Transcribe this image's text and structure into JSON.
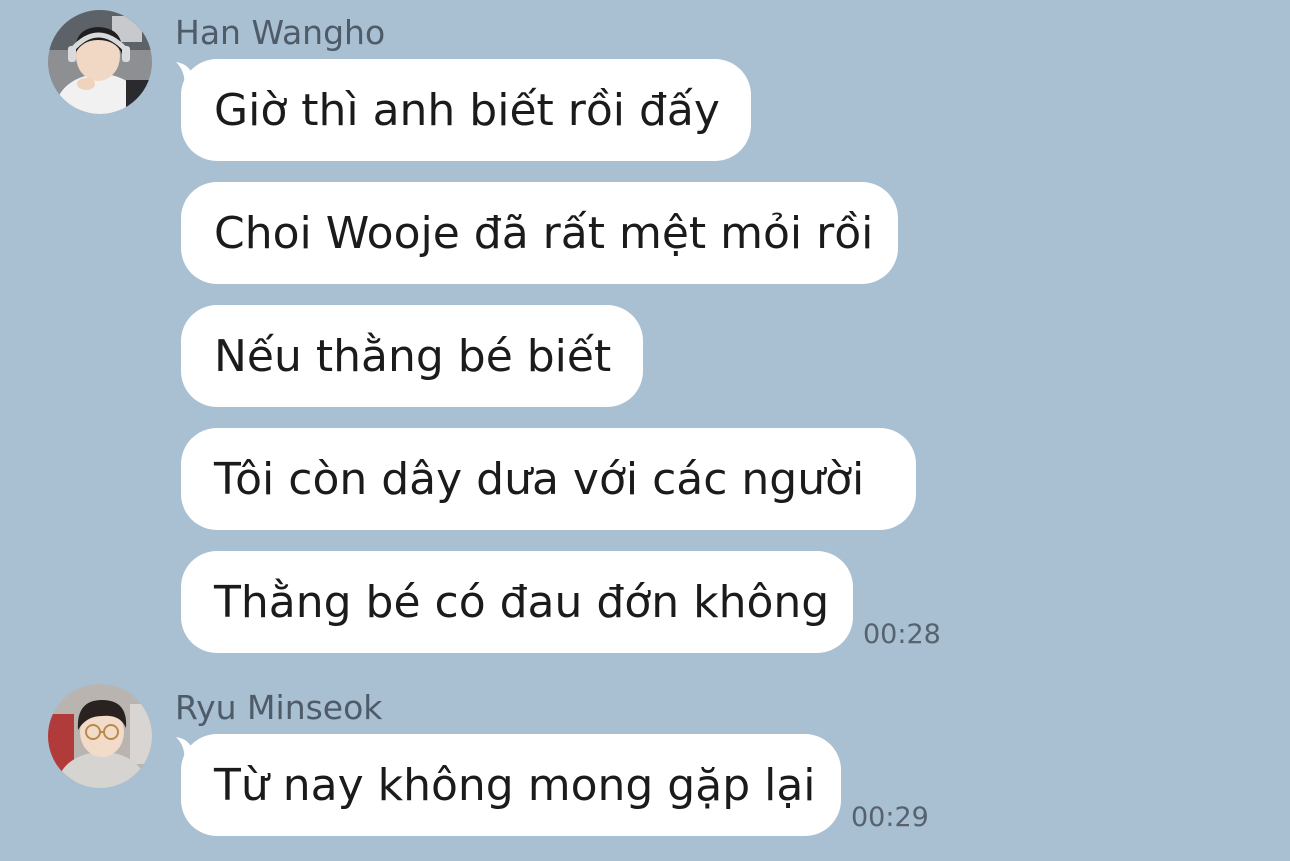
{
  "colors": {
    "background": "#a9bfd2",
    "bubble": "#ffffff",
    "text": "#1b1b1b",
    "sender_name": "#4e5b68",
    "timestamp": "#56636f"
  },
  "groups": [
    {
      "sender": "Han Wangho",
      "avatar_icon": "user-avatar-photo",
      "messages": [
        "Giờ thì anh biết rồi đấy",
        "Choi Wooje đã rất mệt mỏi rồi",
        "Nếu thằng bé biết",
        "Tôi còn dây dưa với các người",
        "Thằng bé có đau đớn không"
      ],
      "time": "00:28"
    },
    {
      "sender": "Ryu Minseok",
      "avatar_icon": "user-avatar-photo",
      "messages": [
        "Từ nay không mong gặp lại"
      ],
      "time": "00:29"
    }
  ]
}
